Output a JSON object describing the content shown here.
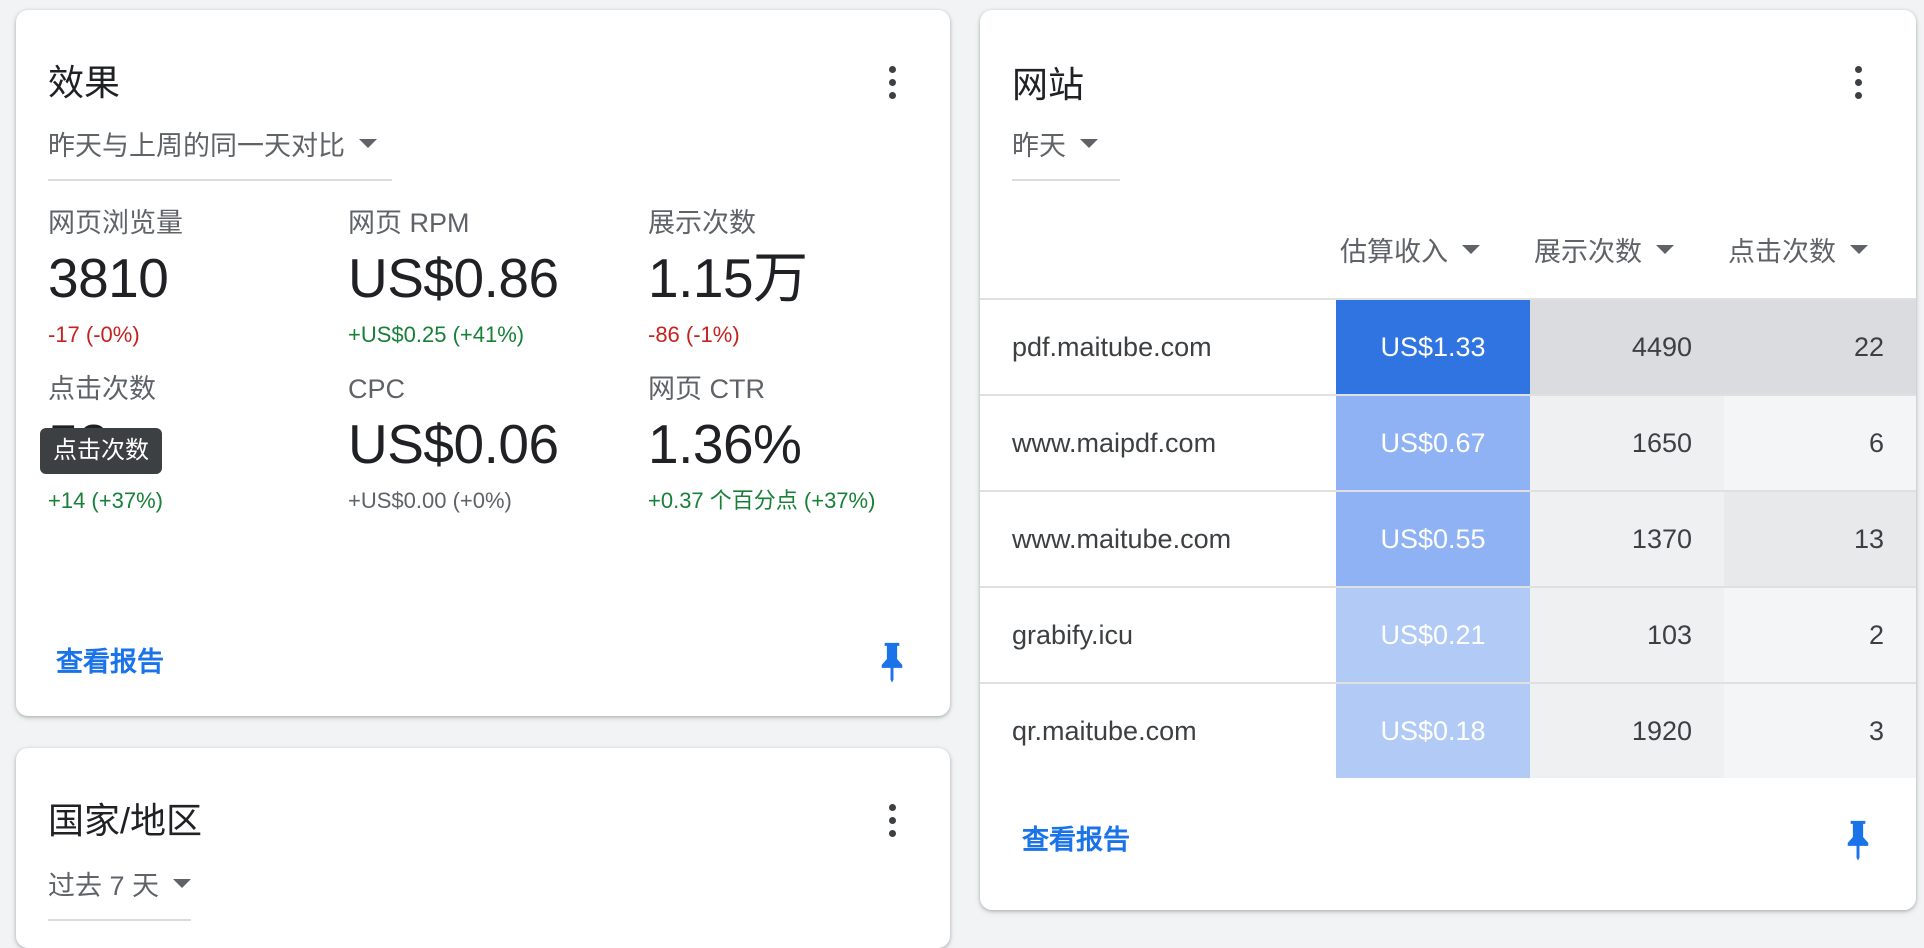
{
  "performance": {
    "title": "效果",
    "comparison": "昨天与上周的同一天对比",
    "metrics": [
      {
        "label": "网页浏览量",
        "value": "3810",
        "delta": "-17 (-0%)",
        "trend": "neg"
      },
      {
        "label": "网页 RPM",
        "value": "US$0.86",
        "delta": "+US$0.25 (+41%)",
        "trend": "pos"
      },
      {
        "label": "展示次数",
        "value": "1.15万",
        "delta": "-86 (-1%)",
        "trend": "neg"
      },
      {
        "label": "点击次数",
        "value": "52",
        "delta": "+14 (+37%)",
        "trend": "pos"
      },
      {
        "label": "CPC",
        "value": "US$0.06",
        "delta": "+US$0.00 (+0%)",
        "trend": "neu"
      },
      {
        "label": "网页 CTR",
        "value": "1.36%",
        "delta": "+0.37 个百分点 (+37%)",
        "trend": "pos"
      }
    ],
    "tooltip": "点击次数",
    "report_link": "查看报告"
  },
  "sites": {
    "title": "网站",
    "period": "昨天",
    "columns": [
      "估算收入",
      "展示次数",
      "点击次数"
    ],
    "rows": [
      {
        "site": "pdf.maitube.com",
        "revenue": "US$1.33",
        "impressions": "4490",
        "clicks": "22"
      },
      {
        "site": "www.maipdf.com",
        "revenue": "US$0.67",
        "impressions": "1650",
        "clicks": "6"
      },
      {
        "site": "www.maitube.com",
        "revenue": "US$0.55",
        "impressions": "1370",
        "clicks": "13"
      },
      {
        "site": "grabify.icu",
        "revenue": "US$0.21",
        "impressions": "103",
        "clicks": "2"
      },
      {
        "site": "qr.maitube.com",
        "revenue": "US$0.18",
        "impressions": "1920",
        "clicks": "3"
      }
    ],
    "report_link": "查看报告"
  },
  "country": {
    "title": "国家/地区",
    "period": "过去 7 天"
  },
  "colors": {
    "link": "#1a73e8",
    "negative": "#c5221f",
    "positive": "#188038",
    "heat_revenue": [
      "#2f74e0",
      "#8eb2f3",
      "#8eb2f3",
      "#b1caf6",
      "#b1caf6"
    ],
    "heat_impressions": [
      "#dadce0",
      "#eff0f2",
      "#eff0f2",
      "#eff0f2",
      "#eff0f2"
    ],
    "heat_clicks": [
      "#dadce0",
      "#f4f5f6",
      "#e8e9eb",
      "#f4f5f6",
      "#f4f5f6"
    ]
  },
  "icons": {
    "menu": "more-vert-icon",
    "pin": "pin-icon",
    "caret": "arrow-drop-down-icon"
  }
}
